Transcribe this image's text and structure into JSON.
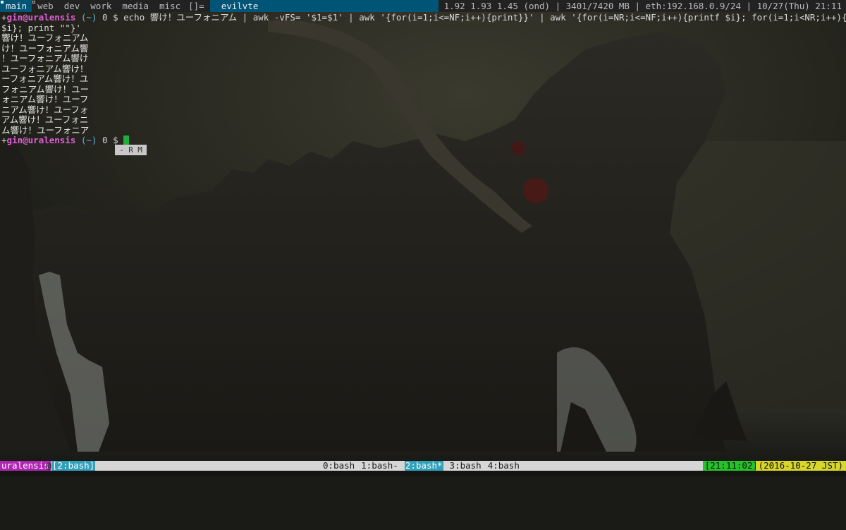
{
  "topbar": {
    "tags": [
      {
        "label": "main",
        "selected": true
      },
      {
        "label": "web",
        "occupied": true
      },
      {
        "label": "dev"
      },
      {
        "label": "work"
      },
      {
        "label": "media"
      },
      {
        "label": "misc"
      }
    ],
    "layout_symbol": "[]=",
    "window_title": "evilvte",
    "status": "1.92 1.93 1.45 (ond) | 3401/7420 MB | eth:192.168.0.9/24 | 10/27(Thu) 21:11"
  },
  "terminal": {
    "prompt": {
      "plus": "+",
      "user": "gin",
      "at": "@",
      "host": "uralensis",
      "dir": " (~)",
      "exit_code": " 0",
      "dollar": " $ "
    },
    "command_line1": "echo 響け！ユーフォニアム | awk -vFS= '$1=$1' | awk '{for(i=1;i<=NF;i++){print}}' | awk '{for(i=NR;i<=NF;i++){printf $i}; for(i=1;i<NR;i++){printf",
    "command_line2": "$i}; print \"\"}'",
    "output": [
      "響け！ユーフォニアム",
      "け！ユーフォニアム響",
      "！ユーフォニアム響け",
      "ユーフォニアム響け！",
      "ーフォニアム響け！ユ",
      "フォニアム響け！ユー",
      "ォニアム響け！ユーフ",
      "ニアム響け！ユーフォ",
      "アム響け！ユーフォニ",
      "ム響け！ユーフォニア"
    ],
    "mode_indicator": [
      "-",
      "R",
      "M"
    ]
  },
  "tmux": {
    "host": "uralensis",
    "at": "@",
    "session": "[2:bash]",
    "windows": [
      {
        "label": "0:bash",
        "active": false
      },
      {
        "label": "1:bash-",
        "active": false
      },
      {
        "label": "2:bash*",
        "active": true
      },
      {
        "label": "3:bash",
        "active": false
      },
      {
        "label": "4:bash",
        "active": false
      }
    ],
    "time": "[21:11:02]",
    "date": "(2016-10-27 JST)"
  },
  "colors": {
    "dwm_selected": "#005577",
    "dwm_bar": "#222222",
    "prompt_user": "#e05fd6",
    "prompt_dir": "#5fb6e0",
    "cursor": "#1fae3a",
    "tmux_host": "#b026b3",
    "tmux_active": "#32a0b8",
    "tmux_time": "#25c22a",
    "tmux_date": "#d8d62a"
  }
}
